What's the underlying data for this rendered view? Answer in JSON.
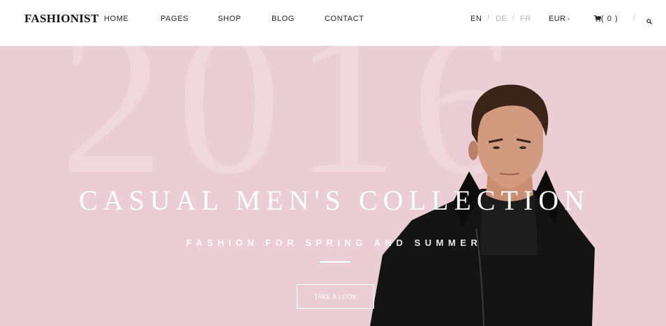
{
  "header": {
    "logo": "FASHIONIST",
    "nav": [
      {
        "label": "HOME"
      },
      {
        "label": "PAGES"
      },
      {
        "label": "SHOP"
      },
      {
        "label": "BLOG"
      },
      {
        "label": "CONTACT"
      }
    ],
    "languages": [
      {
        "label": "EN",
        "active": true
      },
      {
        "label": "DE",
        "active": false
      },
      {
        "label": "FR",
        "active": false
      }
    ],
    "separator": "/",
    "currency": "EUR",
    "currency_icon": "chevron-down-icon",
    "cart_icon": "cart-icon",
    "cart_count": "( 0 )",
    "search_icon": "search-icon"
  },
  "hero": {
    "background_text": "2016",
    "headline": "CASUAL MEN'S COLLECTION",
    "subheadline": "FASHION FOR SPRING AND SUMMER",
    "cta_label": "TAKE A LOOK",
    "background_color": "#ebcdd6"
  }
}
